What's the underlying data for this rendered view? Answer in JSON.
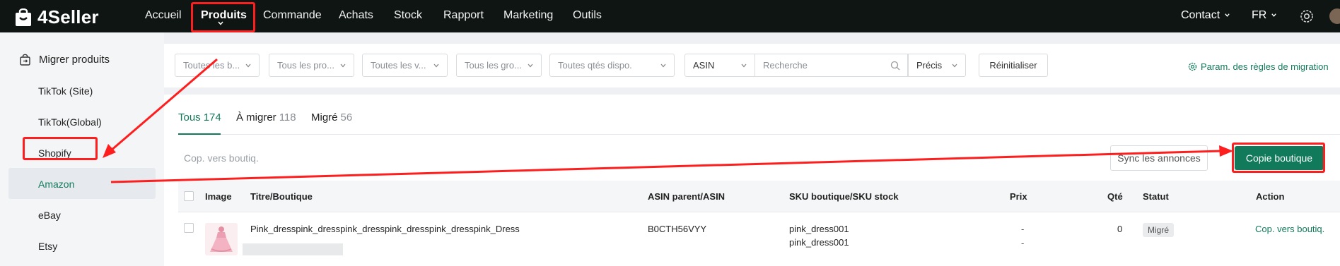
{
  "app": {
    "brand": "4Seller"
  },
  "nav": {
    "items": [
      "Accueil",
      "Produits",
      "Commande",
      "Achats",
      "Stock",
      "Rapport",
      "Marketing",
      "Outils"
    ],
    "active": "Produits",
    "contact": "Contact",
    "lang": "FR"
  },
  "sidebar": {
    "header": "Migrer produits",
    "items": [
      "TikTok (Site)",
      "TikTok(Global)",
      "Shopify",
      "Amazon",
      "eBay",
      "Etsy"
    ],
    "active": "Amazon"
  },
  "filters": {
    "boutique": "Toutes les b...",
    "produits": "Tous les pro...",
    "variantes": "Toutes les v...",
    "groupes": "Tous les gro...",
    "qtes": "Toutes qtés dispo.",
    "field": "ASIN",
    "search_placeholder": "Recherche",
    "match": "Précis",
    "reset": "Réinitialiser",
    "param_link": "Param. des règles de migration"
  },
  "tabs": [
    {
      "label": "Tous",
      "count": "174"
    },
    {
      "label": "À migrer",
      "count": "118"
    },
    {
      "label": "Migré",
      "count": "56"
    }
  ],
  "bulk": {
    "placeholder": "Cop. vers boutiq.",
    "sync": "Sync les annonces",
    "copy": "Copie boutique"
  },
  "table": {
    "headers": [
      "Image",
      "Titre/Boutique",
      "ASIN parent/ASIN",
      "SKU boutique/SKU stock",
      "Prix",
      "Qté",
      "Statut",
      "Action"
    ],
    "rows": [
      {
        "title": "Pink_dresspink_dresspink_dresspink_dresspink_dresspink_Dress",
        "asin": "B0CTH56VYY",
        "sku_boutique": "pink_dress001",
        "sku_stock": "pink_dress001",
        "price1": "-",
        "price2": "-",
        "qty": "0",
        "status": "Migré",
        "action": "Cop. vers boutiq."
      }
    ]
  },
  "colors": {
    "brand_green": "#117a5a",
    "topbar": "#0e1512",
    "annotation_red": "#ff1e1e"
  }
}
